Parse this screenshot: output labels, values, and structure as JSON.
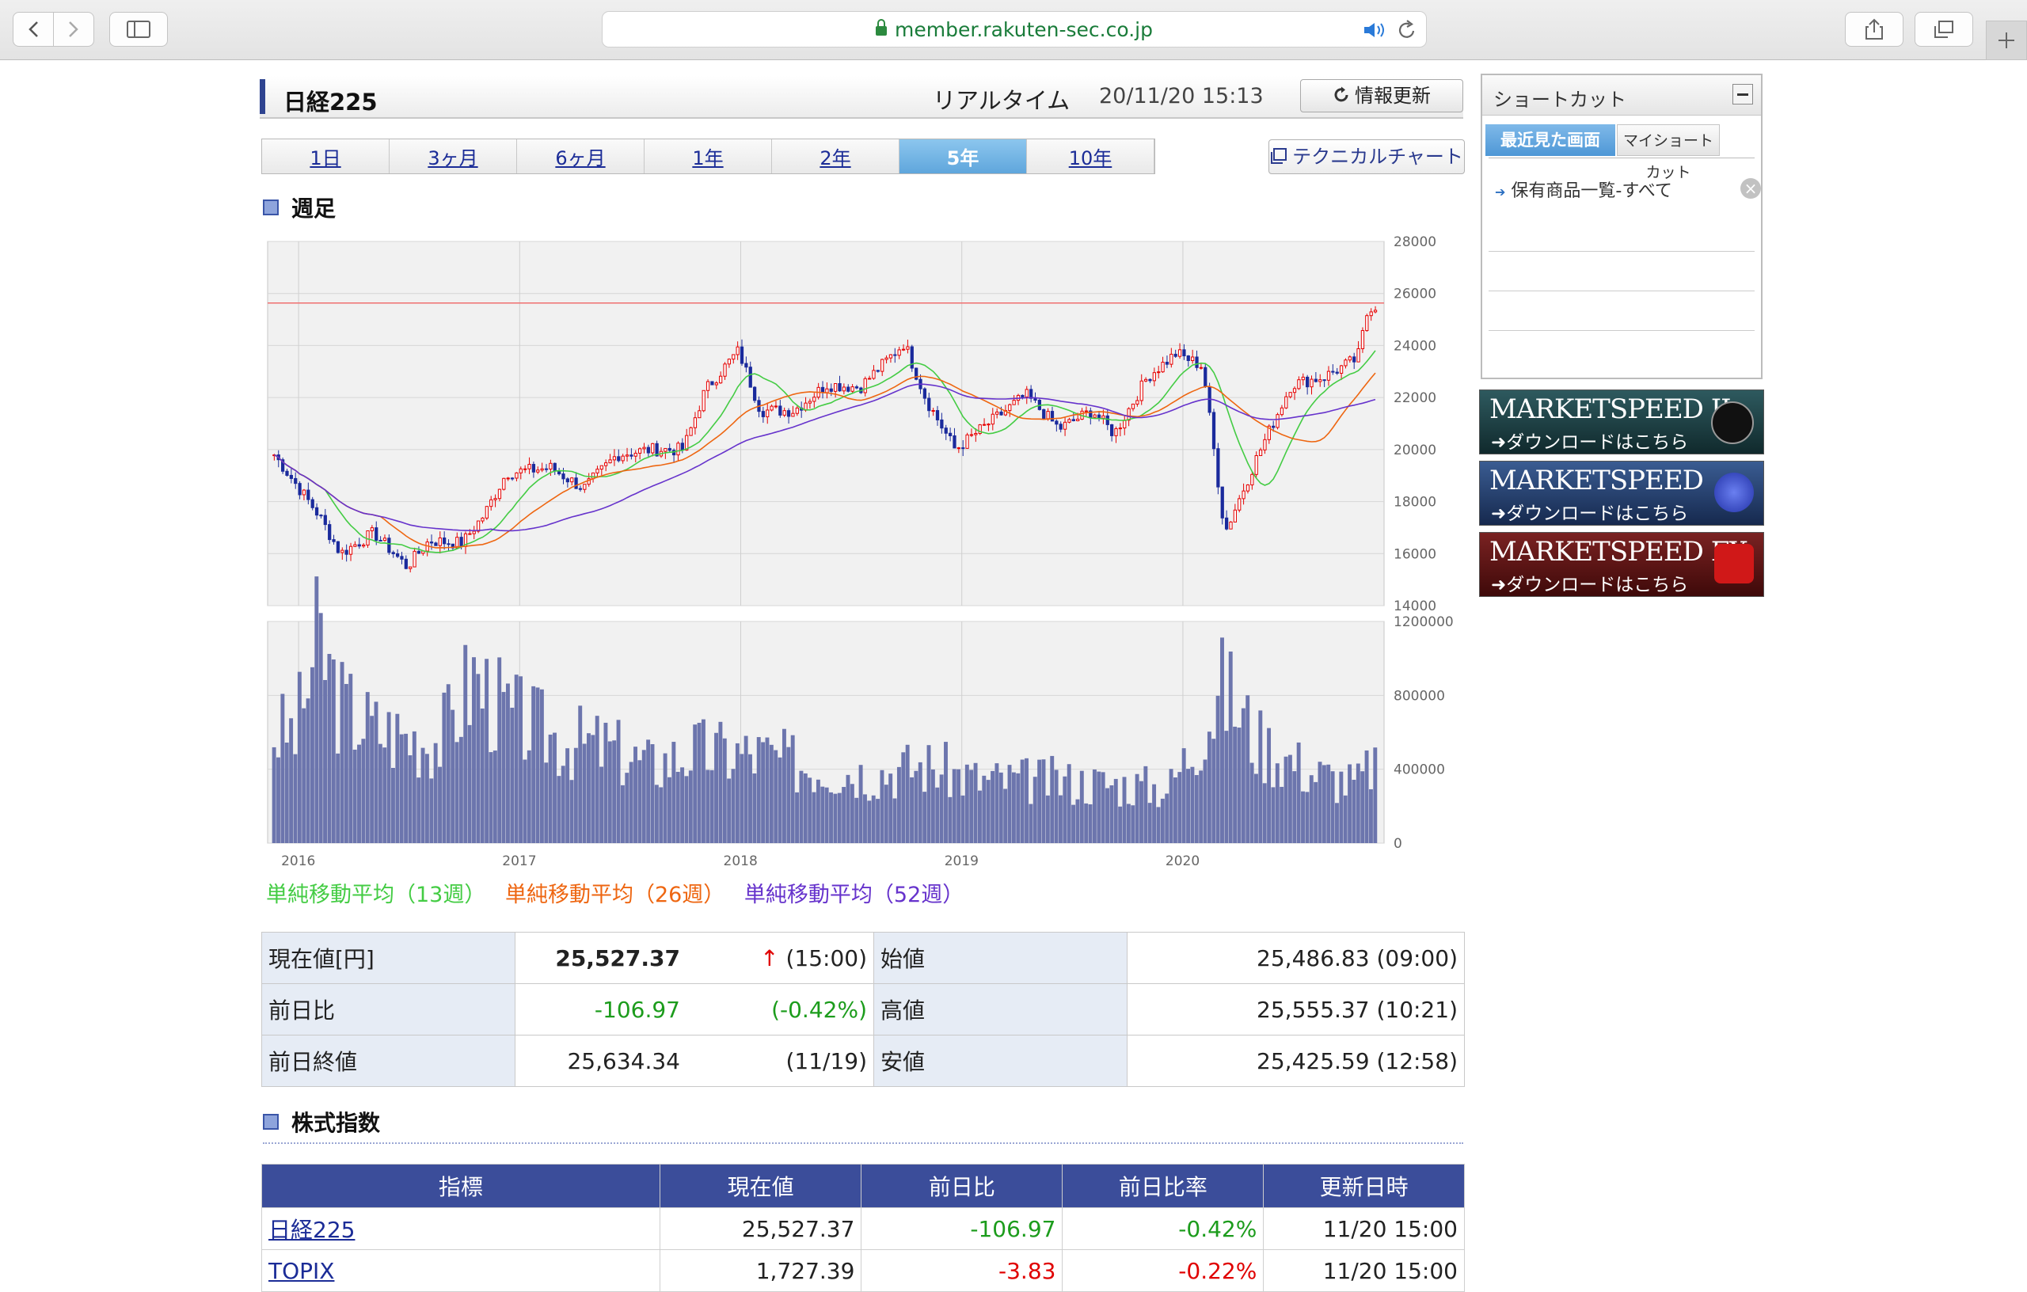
{
  "browser": {
    "url": "member.rakuten-sec.co.jp"
  },
  "header": {
    "title": "日経225",
    "realtime_label": "リアルタイム",
    "timestamp": "20/11/20 15:13",
    "refresh_label": "情報更新"
  },
  "period_tabs": [
    {
      "label": "1日",
      "active": false
    },
    {
      "label": "3ヶ月",
      "active": false
    },
    {
      "label": "6ヶ月",
      "active": false
    },
    {
      "label": "1年",
      "active": false
    },
    {
      "label": "2年",
      "active": false
    },
    {
      "label": "5年",
      "active": true
    },
    {
      "label": "10年",
      "active": false
    }
  ],
  "technical_chart_label": "テクニカルチャート",
  "chart_section_title": "週足",
  "legend": [
    {
      "label": "単純移動平均（13週）",
      "color": "#44cc44"
    },
    {
      "label": "単純移動平均（26週）",
      "color": "#ee6611"
    },
    {
      "label": "単純移動平均（52週）",
      "color": "#6633cc"
    }
  ],
  "chart_data": [
    {
      "type": "candlestick",
      "x_ticks": [
        "2016",
        "2017",
        "2018",
        "2019",
        "2020"
      ],
      "y_ticks": [
        14000,
        16000,
        18000,
        20000,
        22000,
        24000,
        26000,
        28000
      ],
      "ylim": [
        14000,
        28000
      ],
      "grid": true,
      "reference_line": 25634,
      "up_color": "#e60000",
      "down_color": "#1a2a9c",
      "weekly_close_approx": [
        {
          "x": 2015.9,
          "y": 19800
        },
        {
          "x": 2016.1,
          "y": 17500
        },
        {
          "x": 2016.2,
          "y": 16000
        },
        {
          "x": 2016.35,
          "y": 16800
        },
        {
          "x": 2016.5,
          "y": 15500
        },
        {
          "x": 2016.6,
          "y": 16500
        },
        {
          "x": 2016.75,
          "y": 16400
        },
        {
          "x": 2016.85,
          "y": 17500
        },
        {
          "x": 2016.95,
          "y": 19100
        },
        {
          "x": 2017.15,
          "y": 19300
        },
        {
          "x": 2017.3,
          "y": 18500
        },
        {
          "x": 2017.45,
          "y": 19800
        },
        {
          "x": 2017.6,
          "y": 20000
        },
        {
          "x": 2017.75,
          "y": 20000
        },
        {
          "x": 2017.85,
          "y": 22300
        },
        {
          "x": 2018.0,
          "y": 23800
        },
        {
          "x": 2018.1,
          "y": 21500
        },
        {
          "x": 2018.25,
          "y": 21500
        },
        {
          "x": 2018.4,
          "y": 22500
        },
        {
          "x": 2018.55,
          "y": 22400
        },
        {
          "x": 2018.75,
          "y": 24100
        },
        {
          "x": 2018.85,
          "y": 21900
        },
        {
          "x": 2018.98,
          "y": 20000
        },
        {
          "x": 2019.1,
          "y": 20800
        },
        {
          "x": 2019.3,
          "y": 22100
        },
        {
          "x": 2019.45,
          "y": 20800
        },
        {
          "x": 2019.6,
          "y": 21500
        },
        {
          "x": 2019.7,
          "y": 20600
        },
        {
          "x": 2019.85,
          "y": 22800
        },
        {
          "x": 2019.98,
          "y": 23700
        },
        {
          "x": 2020.1,
          "y": 23200
        },
        {
          "x": 2020.2,
          "y": 16800
        },
        {
          "x": 2020.35,
          "y": 19800
        },
        {
          "x": 2020.5,
          "y": 22500
        },
        {
          "x": 2020.65,
          "y": 22800
        },
        {
          "x": 2020.8,
          "y": 23500
        },
        {
          "x": 2020.85,
          "y": 25500
        }
      ]
    },
    {
      "type": "bar",
      "series_name": "出来高",
      "y_ticks": [
        0,
        400000,
        800000,
        1200000
      ],
      "ylim": [
        0,
        1200000
      ],
      "color": "#6c75ad",
      "weekly_volume_approx": [
        {
          "x": 2016.0,
          "y": 600000
        },
        {
          "x": 2016.1,
          "y": 1100000
        },
        {
          "x": 2016.2,
          "y": 750000
        },
        {
          "x": 2016.35,
          "y": 620000
        },
        {
          "x": 2016.5,
          "y": 580000
        },
        {
          "x": 2016.65,
          "y": 560000
        },
        {
          "x": 2016.8,
          "y": 900000
        },
        {
          "x": 2016.95,
          "y": 700000
        },
        {
          "x": 2017.2,
          "y": 560000
        },
        {
          "x": 2017.4,
          "y": 520000
        },
        {
          "x": 2017.6,
          "y": 420000
        },
        {
          "x": 2017.8,
          "y": 500000
        },
        {
          "x": 2018.1,
          "y": 480000
        },
        {
          "x": 2018.3,
          "y": 420000
        },
        {
          "x": 2018.6,
          "y": 380000
        },
        {
          "x": 2018.85,
          "y": 420000
        },
        {
          "x": 2019.1,
          "y": 340000
        },
        {
          "x": 2019.4,
          "y": 340000
        },
        {
          "x": 2019.7,
          "y": 320000
        },
        {
          "x": 2019.95,
          "y": 300000
        },
        {
          "x": 2020.2,
          "y": 850000
        },
        {
          "x": 2020.35,
          "y": 550000
        },
        {
          "x": 2020.6,
          "y": 380000
        },
        {
          "x": 2020.8,
          "y": 320000
        },
        {
          "x": 2020.88,
          "y": 450000
        }
      ]
    }
  ],
  "quote": {
    "price_label": "現在値[円]",
    "price": "25,527.37",
    "price_time": "(15:00)",
    "open_label": "始値",
    "open": "25,486.83 (09:00)",
    "change_label": "前日比",
    "change": "-106.97",
    "change_pct": "(-0.42%)",
    "high_label": "高値",
    "high": "25,555.37 (10:21)",
    "prev_close_label": "前日終値",
    "prev_close": "25,634.34",
    "prev_close_date": "(11/19)",
    "low_label": "安値",
    "low": "25,425.59 (12:58)"
  },
  "indices_section_title": "株式指数",
  "indices_table": {
    "headers": [
      "指標",
      "現在値",
      "前日比",
      "前日比率",
      "更新日時"
    ],
    "rows": [
      [
        "日経225",
        "25,527.37",
        "-106.97",
        "-0.42%",
        "11/20 15:00"
      ],
      [
        "TOPIX",
        "1,727.39",
        "-3.83",
        "-0.22%",
        "11/20 15:00"
      ]
    ]
  },
  "shortcut": {
    "title": "ショートカット",
    "tab_recent": "最近見た画面",
    "tab_my": "マイショートカット",
    "items": [
      "保有商品一覧-すべて"
    ]
  },
  "banners": [
    {
      "name": "MARKETSPEED II",
      "sub": "➜ダウンロードはこちら",
      "color": "#1d3b3f"
    },
    {
      "name": "MARKETSPEED",
      "sub": "➜ダウンロードはこちら",
      "color": "#1f3560"
    },
    {
      "name": "MARKETSPEED FX",
      "sub": "➜ダウンロードはこちら",
      "color": "#5a1414"
    }
  ]
}
